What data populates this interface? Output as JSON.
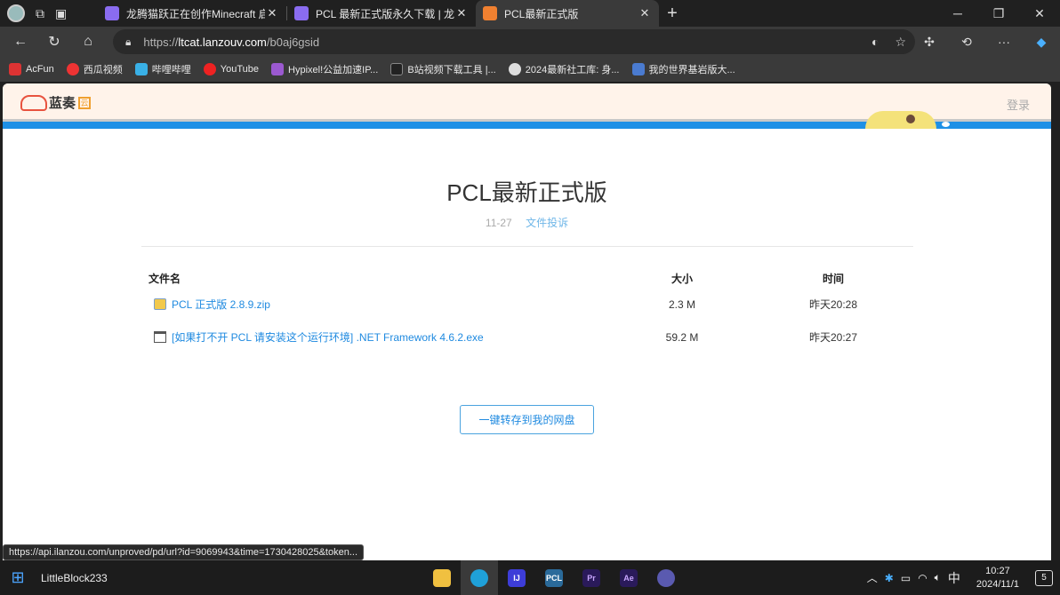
{
  "browser": {
    "tabs": [
      {
        "title": "龙腾猫跃正在创作Minecraft 启动器",
        "favicon_color": "#8a6cf0",
        "active": false
      },
      {
        "title": "PCL 最新正式版永久下载 | 龙腾猫跃",
        "favicon_color": "#8a6cf0",
        "active": false
      },
      {
        "title": "PCL最新正式版",
        "favicon_color": "#f08030",
        "active": true
      }
    ],
    "url_prefix": "https://",
    "url_host": "ltcat.lanzouv.com",
    "url_path": "/b0aj6gsid",
    "bookmarks": [
      {
        "label": "AcFun",
        "color": "#d33"
      },
      {
        "label": "西瓜视频",
        "color": "#e33"
      },
      {
        "label": "哔哩哔哩",
        "color": "#39b0e6"
      },
      {
        "label": "YouTube",
        "color": "#e22"
      },
      {
        "label": "Hypixel!公益加速IP...",
        "color": "#9b59d0"
      },
      {
        "label": "B站视频下载工具 |...",
        "color": "#222"
      },
      {
        "label": "2024最新社工库: 身...",
        "color": "#555"
      },
      {
        "label": "我的世界基岩版大...",
        "color": "#4a7bd0"
      }
    ]
  },
  "site": {
    "logo_text": "蓝奏",
    "logo_badge": "云",
    "login": "登录",
    "page_title": "PCL最新正式版",
    "date": "11-27",
    "report": "文件投诉",
    "columns": {
      "name": "文件名",
      "size": "大小",
      "time": "时间"
    },
    "files": [
      {
        "name": "PCL 正式版 2.8.9.zip",
        "size": "2.3 M",
        "time": "昨天20:28",
        "icon": "zip-icon"
      },
      {
        "name": "[如果打不开 PCL 请安装这个运行环境] .NET Framework 4.6.2.exe",
        "size": "59.2 M",
        "time": "昨天20:27",
        "icon": "exe-icon"
      }
    ],
    "save_button": "一键转存到我的网盘"
  },
  "status_url": "https://api.ilanzou.com/unproved/pd/url?id=9069943&time=1730428025&token...",
  "taskbar": {
    "user": "LittleBlock233",
    "apps": [
      {
        "name": "file-explorer-icon",
        "label": "",
        "color": "#f0c040"
      },
      {
        "name": "edge-icon",
        "label": "",
        "color": "#1fa0d8"
      },
      {
        "name": "intellij-icon",
        "label": "IJ",
        "color": "#3d3dd8"
      },
      {
        "name": "pcl-icon",
        "label": "PCL",
        "color": "#2a6a9a"
      },
      {
        "name": "premiere-icon",
        "label": "Pr",
        "color": "#2a1a5a"
      },
      {
        "name": "after-effects-icon",
        "label": "Ae",
        "color": "#2a1a5a"
      },
      {
        "name": "app-icon",
        "label": "",
        "color": "#5a5ab0"
      }
    ],
    "ime": "中",
    "time": "10:27",
    "date": "2024/11/1",
    "notifications": "5"
  }
}
